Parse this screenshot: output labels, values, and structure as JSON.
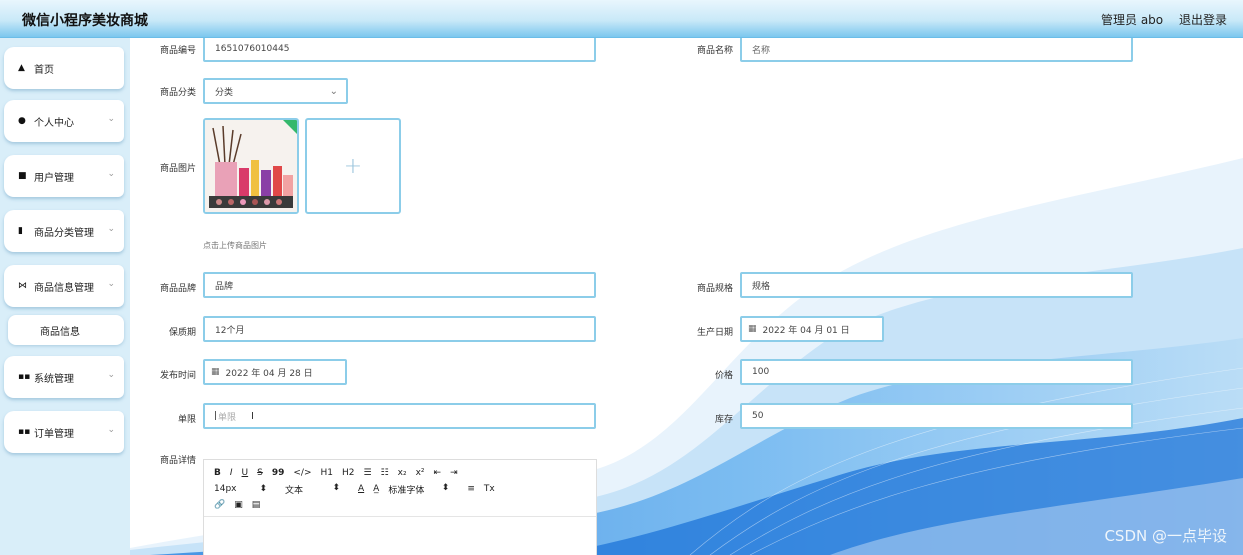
{
  "header": {
    "title": "微信小程序美妆商城",
    "user_label": "管理员 abo",
    "logout": "退出登录"
  },
  "sidebar": {
    "items": [
      {
        "label": "首页"
      },
      {
        "label": "个人中心"
      },
      {
        "label": "用户管理"
      },
      {
        "label": "商品分类管理"
      },
      {
        "label": "商品信息管理"
      },
      {
        "label": "系统管理"
      },
      {
        "label": "订单管理"
      }
    ],
    "sub_item": {
      "label": "商品信息"
    }
  },
  "form": {
    "product_no": {
      "label": "商品编号",
      "value": "1651076010445"
    },
    "product_name": {
      "label": "商品名称",
      "placeholder": "名称"
    },
    "category": {
      "label": "商品分类",
      "value": "分类"
    },
    "image": {
      "label": "商品图片",
      "hint": "点击上传商品图片"
    },
    "brand": {
      "label": "商品品牌",
      "value": "品牌"
    },
    "spec": {
      "label": "商品规格",
      "value": "规格"
    },
    "shelf_life": {
      "label": "保质期",
      "value": "12个月"
    },
    "production_date": {
      "label": "生产日期",
      "value": "2022 年 04 月 01 日"
    },
    "publish_time": {
      "label": "发布时间",
      "value": "2022 年 04 月 28 日"
    },
    "price": {
      "label": "价格",
      "value": "100"
    },
    "limit": {
      "label": "单限",
      "placeholder": "单限"
    },
    "stock": {
      "label": "库存",
      "value": "50"
    },
    "detail": {
      "label": "商品详情"
    }
  },
  "editor": {
    "row1": [
      "B",
      "I",
      "U",
      "S",
      "99",
      "</>",
      "H1",
      "H2",
      "☰",
      "☷",
      "x₂",
      "x²",
      "⇤",
      "⇥"
    ],
    "font_size": "14px",
    "text_type": "文本",
    "font_family": "标准字体",
    "row2_extra": [
      "A",
      "A̲",
      "≡",
      "Tx"
    ],
    "row3": [
      "🔗",
      "▣",
      "▤"
    ]
  },
  "watermark": "CSDN @一点毕设",
  "colors": {
    "accent": "#8ccde9",
    "header_bottom": "#7cc7ee",
    "sidebar_bg": "#d9eef9"
  }
}
